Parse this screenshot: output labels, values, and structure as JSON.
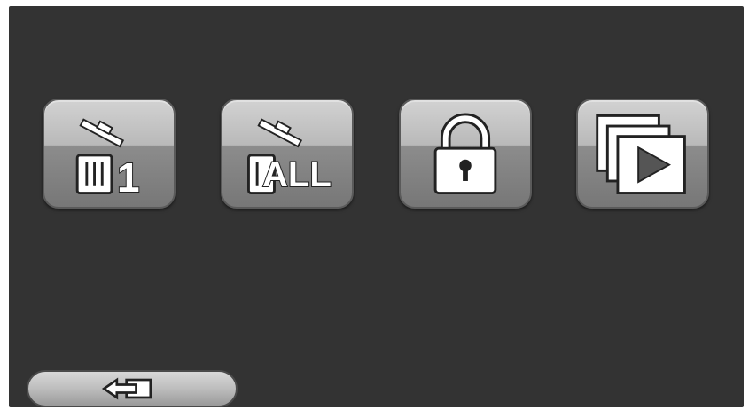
{
  "tiles": [
    {
      "name": "delete-one-button",
      "icon": "trash-one-icon",
      "caption": "1"
    },
    {
      "name": "delete-all-button",
      "icon": "trash-all-icon",
      "caption": "ALL"
    },
    {
      "name": "protect-button",
      "icon": "lock-icon"
    },
    {
      "name": "slideshow-button",
      "icon": "slideshow-icon"
    }
  ],
  "back_button": {
    "icon": "back-arrow-icon"
  }
}
